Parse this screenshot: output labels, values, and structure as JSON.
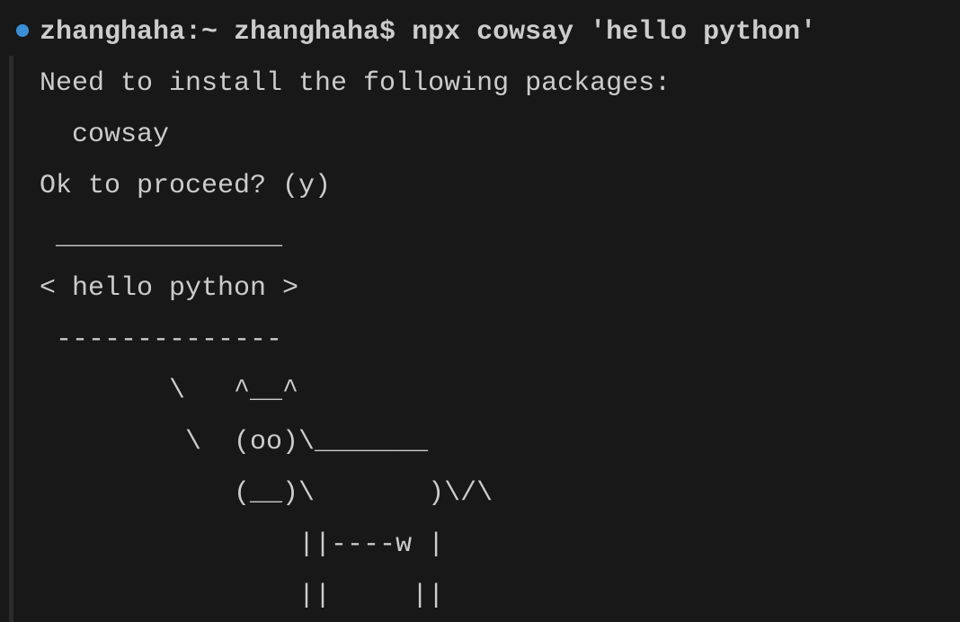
{
  "terminal": {
    "prompt_line": "zhanghaha:~ zhanghaha$ npx cowsay 'hello python'",
    "lines": [
      "Need to install the following packages:",
      "  cowsay",
      "Ok to proceed? (y)",
      " ______________",
      "< hello python >",
      " --------------",
      "        \\   ^__^",
      "         \\  (oo)\\_______",
      "            (__)\\       )\\/\\",
      "                ||----w |",
      "                ||     ||"
    ]
  },
  "colors": {
    "background": "#181818",
    "foreground": "#cccccc",
    "command_decoration": "#3b8fd6"
  }
}
